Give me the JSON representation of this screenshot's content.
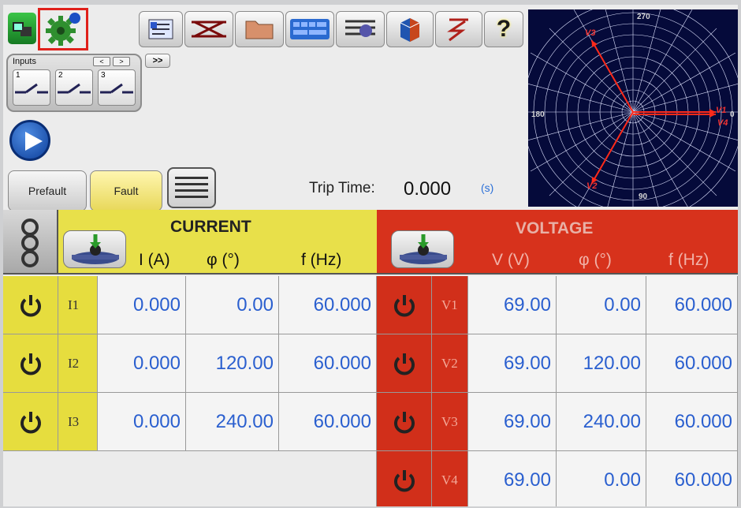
{
  "toolbar": {
    "buttons": [
      "app-icon",
      "settings-gear-icon",
      "ticket-icon",
      "crossover-icon",
      "folder-icon",
      "keypad-icon",
      "tape-icon",
      "cube-icon",
      "lightning-icon",
      "help-icon"
    ],
    "help_label": "?"
  },
  "inputs_panel": {
    "title": "Inputs",
    "prev": "<",
    "next": ">",
    "expand": ">>",
    "inputs": [
      {
        "number": "1"
      },
      {
        "number": "2"
      },
      {
        "number": "3"
      }
    ]
  },
  "controls": {
    "prefault_label": "Prefault",
    "fault_label": "Fault"
  },
  "trip": {
    "label": "Trip Time:",
    "value": "0.000",
    "unit": "(s)"
  },
  "polar": {
    "top": "270",
    "left": "180",
    "right": "0",
    "bottom": "90",
    "phasors": [
      "V1",
      "V2",
      "V3",
      "V4"
    ]
  },
  "current": {
    "title": "CURRENT",
    "columns": [
      "I (A)",
      "φ  (°)",
      "f  (Hz)"
    ],
    "rows": [
      {
        "label": "I1",
        "amp": "0.000",
        "phase": "0.00",
        "freq": "60.000"
      },
      {
        "label": "I2",
        "amp": "0.000",
        "phase": "120.00",
        "freq": "60.000"
      },
      {
        "label": "I3",
        "amp": "0.000",
        "phase": "240.00",
        "freq": "60.000"
      }
    ]
  },
  "voltage": {
    "title": "VOLTAGE",
    "columns": [
      "V (V)",
      "φ  (°)",
      "f  (Hz)"
    ],
    "rows": [
      {
        "label": "V1",
        "mag": "69.00",
        "phase": "0.00",
        "freq": "60.000"
      },
      {
        "label": "V2",
        "mag": "69.00",
        "phase": "120.00",
        "freq": "60.000"
      },
      {
        "label": "V3",
        "mag": "69.00",
        "phase": "240.00",
        "freq": "60.000"
      },
      {
        "label": "V4",
        "mag": "69.00",
        "phase": "0.00",
        "freq": "60.000"
      }
    ]
  },
  "colors": {
    "current_header": "#e8e04a",
    "voltage_header": "#d7321c",
    "value_text": "#2a5fcf",
    "highlight_box": "#e0201a"
  }
}
